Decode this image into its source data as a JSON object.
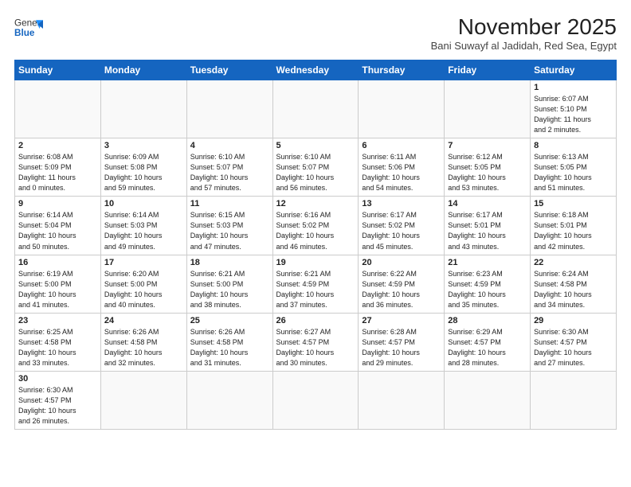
{
  "header": {
    "logo_general": "General",
    "logo_blue": "Blue",
    "month_title": "November 2025",
    "location": "Bani Suwayf al Jadidah, Red Sea, Egypt"
  },
  "days_of_week": [
    "Sunday",
    "Monday",
    "Tuesday",
    "Wednesday",
    "Thursday",
    "Friday",
    "Saturday"
  ],
  "weeks": [
    [
      {
        "day": "",
        "info": ""
      },
      {
        "day": "",
        "info": ""
      },
      {
        "day": "",
        "info": ""
      },
      {
        "day": "",
        "info": ""
      },
      {
        "day": "",
        "info": ""
      },
      {
        "day": "",
        "info": ""
      },
      {
        "day": "1",
        "info": "Sunrise: 6:07 AM\nSunset: 5:10 PM\nDaylight: 11 hours\nand 2 minutes."
      }
    ],
    [
      {
        "day": "2",
        "info": "Sunrise: 6:08 AM\nSunset: 5:09 PM\nDaylight: 11 hours\nand 0 minutes."
      },
      {
        "day": "3",
        "info": "Sunrise: 6:09 AM\nSunset: 5:08 PM\nDaylight: 10 hours\nand 59 minutes."
      },
      {
        "day": "4",
        "info": "Sunrise: 6:10 AM\nSunset: 5:07 PM\nDaylight: 10 hours\nand 57 minutes."
      },
      {
        "day": "5",
        "info": "Sunrise: 6:10 AM\nSunset: 5:07 PM\nDaylight: 10 hours\nand 56 minutes."
      },
      {
        "day": "6",
        "info": "Sunrise: 6:11 AM\nSunset: 5:06 PM\nDaylight: 10 hours\nand 54 minutes."
      },
      {
        "day": "7",
        "info": "Sunrise: 6:12 AM\nSunset: 5:05 PM\nDaylight: 10 hours\nand 53 minutes."
      },
      {
        "day": "8",
        "info": "Sunrise: 6:13 AM\nSunset: 5:05 PM\nDaylight: 10 hours\nand 51 minutes."
      }
    ],
    [
      {
        "day": "9",
        "info": "Sunrise: 6:14 AM\nSunset: 5:04 PM\nDaylight: 10 hours\nand 50 minutes."
      },
      {
        "day": "10",
        "info": "Sunrise: 6:14 AM\nSunset: 5:03 PM\nDaylight: 10 hours\nand 49 minutes."
      },
      {
        "day": "11",
        "info": "Sunrise: 6:15 AM\nSunset: 5:03 PM\nDaylight: 10 hours\nand 47 minutes."
      },
      {
        "day": "12",
        "info": "Sunrise: 6:16 AM\nSunset: 5:02 PM\nDaylight: 10 hours\nand 46 minutes."
      },
      {
        "day": "13",
        "info": "Sunrise: 6:17 AM\nSunset: 5:02 PM\nDaylight: 10 hours\nand 45 minutes."
      },
      {
        "day": "14",
        "info": "Sunrise: 6:17 AM\nSunset: 5:01 PM\nDaylight: 10 hours\nand 43 minutes."
      },
      {
        "day": "15",
        "info": "Sunrise: 6:18 AM\nSunset: 5:01 PM\nDaylight: 10 hours\nand 42 minutes."
      }
    ],
    [
      {
        "day": "16",
        "info": "Sunrise: 6:19 AM\nSunset: 5:00 PM\nDaylight: 10 hours\nand 41 minutes."
      },
      {
        "day": "17",
        "info": "Sunrise: 6:20 AM\nSunset: 5:00 PM\nDaylight: 10 hours\nand 40 minutes."
      },
      {
        "day": "18",
        "info": "Sunrise: 6:21 AM\nSunset: 5:00 PM\nDaylight: 10 hours\nand 38 minutes."
      },
      {
        "day": "19",
        "info": "Sunrise: 6:21 AM\nSunset: 4:59 PM\nDaylight: 10 hours\nand 37 minutes."
      },
      {
        "day": "20",
        "info": "Sunrise: 6:22 AM\nSunset: 4:59 PM\nDaylight: 10 hours\nand 36 minutes."
      },
      {
        "day": "21",
        "info": "Sunrise: 6:23 AM\nSunset: 4:59 PM\nDaylight: 10 hours\nand 35 minutes."
      },
      {
        "day": "22",
        "info": "Sunrise: 6:24 AM\nSunset: 4:58 PM\nDaylight: 10 hours\nand 34 minutes."
      }
    ],
    [
      {
        "day": "23",
        "info": "Sunrise: 6:25 AM\nSunset: 4:58 PM\nDaylight: 10 hours\nand 33 minutes."
      },
      {
        "day": "24",
        "info": "Sunrise: 6:26 AM\nSunset: 4:58 PM\nDaylight: 10 hours\nand 32 minutes."
      },
      {
        "day": "25",
        "info": "Sunrise: 6:26 AM\nSunset: 4:58 PM\nDaylight: 10 hours\nand 31 minutes."
      },
      {
        "day": "26",
        "info": "Sunrise: 6:27 AM\nSunset: 4:57 PM\nDaylight: 10 hours\nand 30 minutes."
      },
      {
        "day": "27",
        "info": "Sunrise: 6:28 AM\nSunset: 4:57 PM\nDaylight: 10 hours\nand 29 minutes."
      },
      {
        "day": "28",
        "info": "Sunrise: 6:29 AM\nSunset: 4:57 PM\nDaylight: 10 hours\nand 28 minutes."
      },
      {
        "day": "29",
        "info": "Sunrise: 6:30 AM\nSunset: 4:57 PM\nDaylight: 10 hours\nand 27 minutes."
      }
    ],
    [
      {
        "day": "30",
        "info": "Sunrise: 6:30 AM\nSunset: 4:57 PM\nDaylight: 10 hours\nand 26 minutes."
      },
      {
        "day": "",
        "info": ""
      },
      {
        "day": "",
        "info": ""
      },
      {
        "day": "",
        "info": ""
      },
      {
        "day": "",
        "info": ""
      },
      {
        "day": "",
        "info": ""
      },
      {
        "day": "",
        "info": ""
      }
    ]
  ]
}
